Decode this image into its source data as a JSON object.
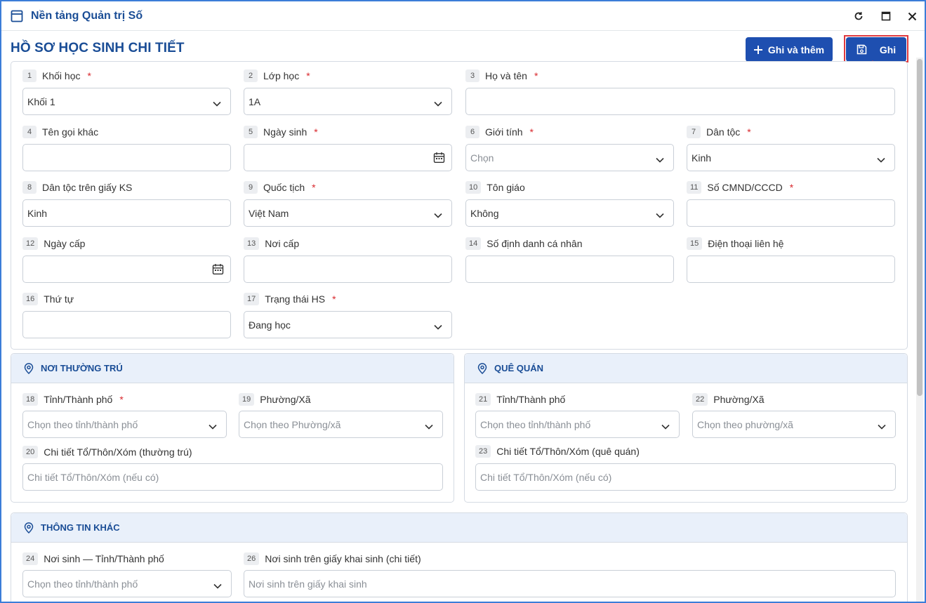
{
  "window": {
    "title": "Nền tảng Quản trị Số"
  },
  "header": {
    "title": "HỒ SƠ HỌC SINH CHI TIẾT",
    "add_button": "Ghi và thêm",
    "save_button": "Ghi"
  },
  "colors": {
    "primary": "#1e4fb0",
    "title": "#1a4d96",
    "required": "#d9292e",
    "highlight": "#e0393e"
  },
  "fields": [
    {
      "num": "1",
      "label": "Khối học",
      "required": true,
      "value": "Khối 1",
      "type": "select"
    },
    {
      "num": "2",
      "label": "Lớp học",
      "required": true,
      "value": "1A",
      "type": "select"
    },
    {
      "num": "3",
      "label": "Họ và tên",
      "required": true,
      "value": "",
      "type": "text"
    },
    {
      "num": "4",
      "label": "Tên gọi khác",
      "required": false,
      "value": "",
      "type": "text"
    },
    {
      "num": "5",
      "label": "Ngày sinh",
      "required": true,
      "value": "",
      "type": "date"
    },
    {
      "num": "6",
      "label": "Giới tính",
      "required": true,
      "placeholder": "Chọn",
      "type": "select"
    },
    {
      "num": "7",
      "label": "Dân tộc",
      "required": true,
      "value": "Kinh",
      "type": "select"
    },
    {
      "num": "8",
      "label": "Dân tộc trên giấy KS",
      "required": false,
      "value": "Kinh",
      "type": "text"
    },
    {
      "num": "9",
      "label": "Quốc tịch",
      "required": true,
      "value": "Việt Nam",
      "type": "select"
    },
    {
      "num": "10",
      "label": "Tôn giáo",
      "required": false,
      "value": "Không",
      "type": "select"
    },
    {
      "num": "11",
      "label": "Số CMND/CCCD",
      "required": true,
      "value": "",
      "type": "text"
    },
    {
      "num": "12",
      "label": "Ngày cấp",
      "required": false,
      "value": "",
      "type": "date"
    },
    {
      "num": "13",
      "label": "Nơi cấp",
      "required": false,
      "value": "",
      "type": "text"
    },
    {
      "num": "14",
      "label": "Số định danh cá nhân",
      "required": false,
      "value": "",
      "type": "text"
    },
    {
      "num": "15",
      "label": "Điện thoại liên hệ",
      "required": false,
      "value": "",
      "type": "text"
    },
    {
      "num": "16",
      "label": "Thứ tự",
      "required": false,
      "value": "",
      "type": "text"
    },
    {
      "num": "17",
      "label": "Trạng thái HS",
      "required": true,
      "value": "Đang học",
      "type": "select"
    }
  ],
  "noi_thuong_tru": {
    "title": "NƠI THƯỜNG TRÚ",
    "fields": [
      {
        "num": "18",
        "label": "Tỉnh/Thành phố",
        "required": true,
        "placeholder": "Chọn theo tỉnh/thành phố"
      },
      {
        "num": "19",
        "label": "Phường/Xã",
        "required": false,
        "placeholder": "Chọn theo Phường/xã"
      },
      {
        "num": "20",
        "label": "Chi tiết Tổ/Thôn/Xóm (thường trú)",
        "required": false,
        "placeholder": "Chi tiết Tổ/Thôn/Xóm (nếu có)"
      }
    ]
  },
  "que_quan": {
    "title": "QUÊ QUÁN",
    "fields": [
      {
        "num": "21",
        "label": "Tỉnh/Thành phố",
        "required": false,
        "placeholder": "Chọn theo tỉnh/thành phố"
      },
      {
        "num": "22",
        "label": "Phường/Xã",
        "required": false,
        "placeholder": "Chọn theo phường/xã"
      },
      {
        "num": "23",
        "label": "Chi tiết Tổ/Thôn/Xóm (quê quán)",
        "required": false,
        "placeholder": "Chi tiết Tổ/Thôn/Xóm (nếu có)"
      }
    ]
  },
  "thong_tin_khac": {
    "title": "THÔNG TIN KHÁC",
    "fields": [
      {
        "num": "24",
        "label": "Nơi sinh — Tỉnh/Thành phố",
        "required": false,
        "placeholder": "Chọn theo tỉnh/thành phố"
      },
      {
        "num": "26",
        "label": "Nơi sinh trên giấy khai sinh (chi tiết)",
        "required": false,
        "placeholder": "Nơi sinh trên giấy khai sinh"
      }
    ]
  }
}
